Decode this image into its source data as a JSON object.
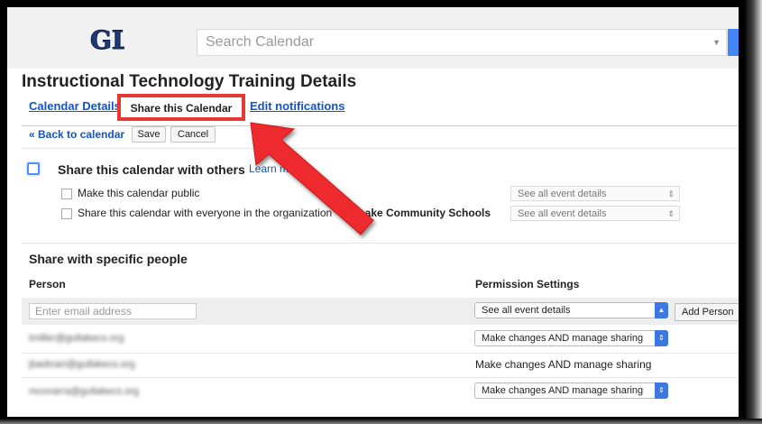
{
  "app": {
    "logo_text": "GL",
    "search_placeholder": "Search Calendar"
  },
  "page": {
    "title": "Instructional Technology Training Details"
  },
  "tabs": [
    {
      "label": "Calendar Details"
    },
    {
      "label": "Share this Calendar",
      "active": true
    },
    {
      "label": "Edit notifications"
    }
  ],
  "actions": {
    "back": "« Back to calendar",
    "save": "Save",
    "cancel": "Cancel"
  },
  "sharing": {
    "share_with_others": "Share this calendar with others",
    "learn_more": "Learn m",
    "public_label": "Make this calendar public",
    "public_select": "See all event details",
    "org_label_pre": "Share this calendar with everyone in the organization",
    "org_name": "ull Lake Community Schools",
    "org_select": "See all event details"
  },
  "specific": {
    "heading": "Share with specific people",
    "col_person": "Person",
    "col_permission": "Permission Settings",
    "email_placeholder": "Enter email address",
    "entry_permission": "See all event details",
    "add_person": "Add Person",
    "rows": [
      {
        "person": "tmiller@gullakecs.org",
        "permission": "Make changes AND manage sharing",
        "editable": true
      },
      {
        "person": "jbadinari@gullakecs.org",
        "permission": "Make changes AND manage sharing",
        "editable": false
      },
      {
        "person": "mcovarra@gullakecs.org",
        "permission": "Make changes AND manage sharing",
        "editable": true
      }
    ]
  },
  "colors": {
    "link": "#1155cc",
    "annotation_red": "#e53935",
    "accent_blue": "#3c78e0"
  },
  "icons": {
    "dropdown": "chevron-updown-icon",
    "annotation": "red-arrow-icon"
  }
}
